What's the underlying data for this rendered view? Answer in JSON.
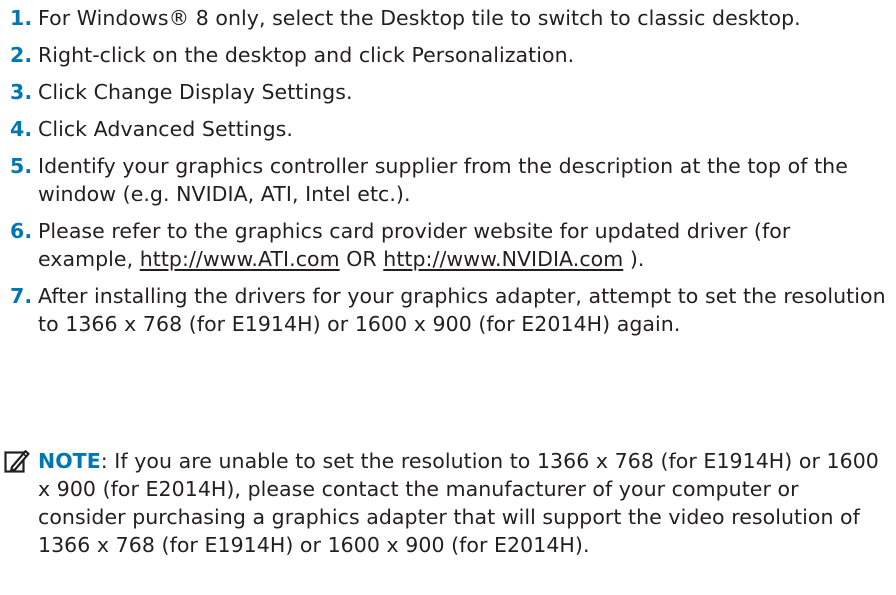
{
  "steps": [
    {
      "number": "1.",
      "text": "For Windows® 8 only, select the Desktop tile to switch to classic desktop."
    },
    {
      "number": "2.",
      "text": "Right-click on the desktop and click Personalization."
    },
    {
      "number": "3.",
      "text": "Click Change Display Settings."
    },
    {
      "number": "4.",
      "text": "Click Advanced Settings."
    },
    {
      "number": "5.",
      "text": "Identify your graphics controller supplier from the description at the top of the window (e.g. NVIDIA, ATI, Intel etc.)."
    },
    {
      "number": "6.",
      "text_before": "Please refer to the graphics card provider website for updated driver (for example, ",
      "link1": "http://www.ATI.com",
      "text_middle": " OR ",
      "link2": "http://www.NVIDIA.com",
      "text_after": " )."
    },
    {
      "number": "7.",
      "text": "After installing the drivers for your graphics adapter, attempt to set the resolution to 1366 x 768 (for E1914H) or 1600 x 900 (for E2014H) again."
    }
  ],
  "note": {
    "icon": "pencil-note-icon",
    "label": "NOTE",
    "text": ": If you are unable to set the resolution to 1366 x 768 (for E1914H) or 1600 x 900 (for E2014H), please contact the manufacturer of your computer or consider purchasing a graphics adapter that will support the video resolution of 1366 x 768 (for E1914H) or 1600 x 900 (for E2014H)."
  },
  "colors": {
    "accent": "#0077b3",
    "text": "#231f20"
  }
}
